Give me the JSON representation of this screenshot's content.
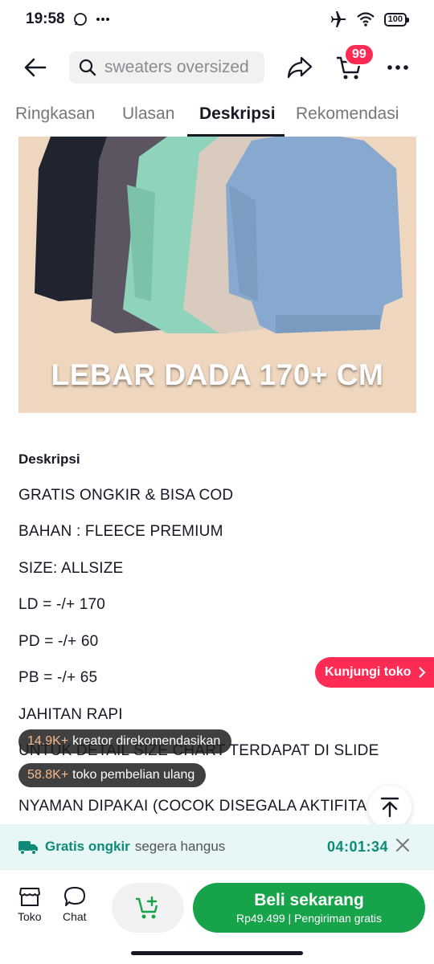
{
  "status_bar": {
    "time": "19:58",
    "battery": "100",
    "icons": [
      "whatsapp-icon",
      "more-dots-icon",
      "airplane-icon",
      "wifi-icon",
      "battery-icon"
    ]
  },
  "header": {
    "search_placeholder": "sweaters oversized",
    "cart_badge": "99",
    "icons": [
      "back-arrow-icon",
      "search-icon",
      "share-icon",
      "cart-icon",
      "more-icon"
    ]
  },
  "tabs": [
    {
      "label": "Ringkasan",
      "active": false
    },
    {
      "label": "Ulasan",
      "active": false
    },
    {
      "label": "Deskripsi",
      "active": true
    },
    {
      "label": "Rekomendasi",
      "active": false
    }
  ],
  "hero": {
    "caption": "LEBAR DADA 170+ CM",
    "background": "#efd7bf",
    "sweater_colors": [
      "#1f2430",
      "#5a5560",
      "#8fd3bd",
      "#d9cbbd",
      "#88a9cf"
    ]
  },
  "description": {
    "title": "Deskripsi",
    "lines": [
      "GRATIS ONGKIR & BISA COD",
      "BAHAN : FLEECE PREMIUM",
      "SIZE: ALLSIZE",
      "LD = -/+ 170",
      "PD = -/+ 60",
      "PB = -/+ 65",
      "JAHITAN RAPI",
      "UNTUK DETAIL SIZE CHART TERDAPAT DI SLIDE",
      "NYAMAN DIPAKAI (COCOK DISEGALA AKTIFITA"
    ]
  },
  "visit_store": {
    "label": "Kunjungi toko"
  },
  "chips": [
    {
      "number": "14.9K+",
      "text": "kreator direkomendasikan"
    },
    {
      "number": "58.8K+",
      "text": "toko pembelian ulang"
    }
  ],
  "promo": {
    "strong": "Gratis ongkir",
    "rest": "segera hangus",
    "timer": "04:01:34"
  },
  "bottom": {
    "store_label": "Toko",
    "chat_label": "Chat",
    "buy_label": "Beli sekarang",
    "buy_price": "Rp49.499",
    "buy_shipping": "Pengiriman gratis"
  },
  "colors": {
    "accent_red": "#fe2c55",
    "buy_green": "#16a34a",
    "promo_teal": "#0d8a78"
  }
}
